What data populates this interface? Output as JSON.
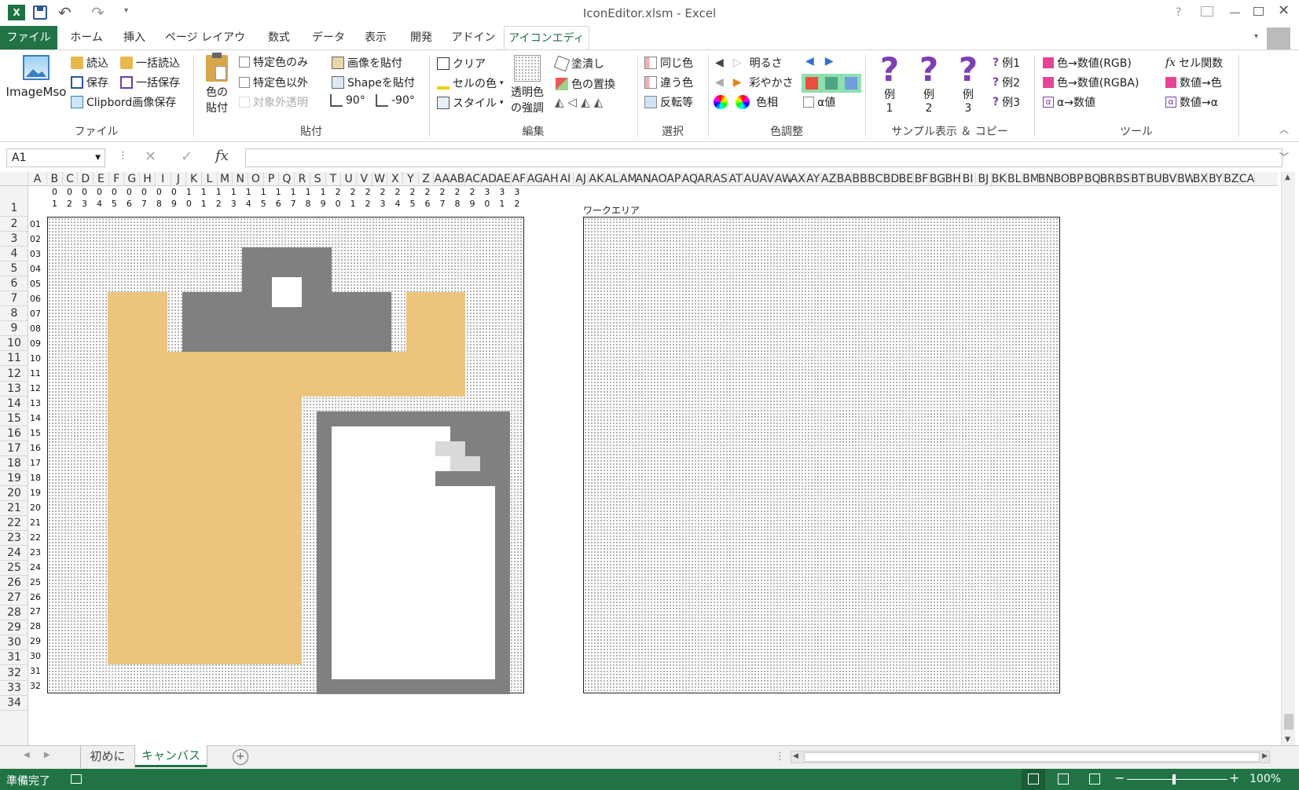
{
  "window": {
    "title": "IconEditor.xlsm - Excel"
  },
  "tabs": [
    "ファイル",
    "ホーム",
    "挿入",
    "ページ レイアウト",
    "数式",
    "データ",
    "表示",
    "開発",
    "アドイン",
    "アイコンエディタ"
  ],
  "ribbon": {
    "file": {
      "imagemso": "ImageMso",
      "load": "読込",
      "bulk_load": "一括読込",
      "save": "保存",
      "bulk_save": "一括保存",
      "clipboard_save": "Clipbord画像保存",
      "group": "ファイル"
    },
    "paste": {
      "color_paste_1": "色の",
      "color_paste_2": "貼付",
      "specific_only": "特定色のみ",
      "specific_except": "特定色以外",
      "transparent": "対象外透明",
      "paste_image": "画像を貼付",
      "paste_shape": "Shapeを貼付",
      "rot90": "90°",
      "rotm90": "-90°",
      "group": "貼付"
    },
    "edit": {
      "clear": "クリア",
      "cell_color": "セルの色",
      "style": "スタイル",
      "emph_1": "透明色",
      "emph_2": "の強調",
      "fill": "塗潰し",
      "replace": "色の置換",
      "group": "編集"
    },
    "select": {
      "same": "同じ色",
      "diff": "違う色",
      "invert": "反転等",
      "group": "選択"
    },
    "color": {
      "brightness": "明るさ",
      "saturation": "彩やかさ",
      "hue": "色相",
      "alpha": "α値",
      "group": "色調整",
      "swatches": [
        "#e8503a",
        "#4ea584",
        "#6e9de0"
      ]
    },
    "sample": {
      "ex_label": "例",
      "ex_nums": [
        "1",
        "2",
        "3"
      ],
      "ex1": "例1",
      "ex2": "例2",
      "ex3": "例3",
      "group": "サンプル表示 ＆ コピー"
    },
    "tools": {
      "c2rgb": "色→数値(RGB)",
      "c2rgba": "色→数値(RGBA)",
      "a2num": "α→数値",
      "cellfunc": "セル関数",
      "num2c": "数値→色",
      "num2a": "数値→α",
      "group": "ツール"
    }
  },
  "formula": {
    "namebox": "A1",
    "value": ""
  },
  "sheet": {
    "col_headers": [
      "A",
      "B",
      "C",
      "D",
      "E",
      "F",
      "G",
      "H",
      "I",
      "J",
      "K",
      "L",
      "M",
      "N",
      "O",
      "P",
      "Q",
      "R",
      "S",
      "T",
      "U",
      "V",
      "W",
      "X",
      "Y",
      "Z",
      "AA",
      "AB",
      "AC",
      "AD",
      "AE",
      "AF",
      "AG",
      "AH",
      "AI",
      "AJ",
      "AK",
      "AL",
      "AM",
      "AN",
      "AO",
      "AP",
      "AQ",
      "AR",
      "AS",
      "AT",
      "AU",
      "AV",
      "AW",
      "AX",
      "AY",
      "AZ",
      "BA",
      "BB",
      "BC",
      "BD",
      "BE",
      "BF",
      "BG",
      "BH",
      "BI",
      "BJ",
      "BK",
      "BL",
      "BM",
      "BN",
      "BO",
      "BP",
      "BQ",
      "BR",
      "BS",
      "BT",
      "BU",
      "BV",
      "BW",
      "BX",
      "BY",
      "BZ",
      "CA"
    ],
    "col_tens": [
      "0",
      "0",
      "0",
      "0",
      "0",
      "0",
      "0",
      "0",
      "0",
      "1",
      "1",
      "1",
      "1",
      "1",
      "1",
      "1",
      "1",
      "1",
      "1",
      "2",
      "2",
      "2",
      "2",
      "2",
      "2",
      "2",
      "2",
      "2",
      "2",
      "3",
      "3",
      "3"
    ],
    "col_ones": [
      "1",
      "2",
      "3",
      "4",
      "5",
      "6",
      "7",
      "8",
      "9",
      "0",
      "1",
      "2",
      "3",
      "4",
      "5",
      "6",
      "7",
      "8",
      "9",
      "0",
      "1",
      "2",
      "3",
      "4",
      "5",
      "6",
      "7",
      "8",
      "9",
      "0",
      "1",
      "2"
    ],
    "row_headers": [
      "1",
      "2",
      "3",
      "4",
      "5",
      "6",
      "7",
      "8",
      "9",
      "10",
      "11",
      "12",
      "13",
      "14",
      "15",
      "16",
      "17",
      "18",
      "19",
      "20",
      "21",
      "22",
      "23",
      "24",
      "25",
      "26",
      "27",
      "28",
      "29",
      "30",
      "31",
      "32",
      "33",
      "34"
    ],
    "row_labels": [
      "01",
      "02",
      "03",
      "04",
      "05",
      "06",
      "07",
      "08",
      "09",
      "10",
      "11",
      "12",
      "13",
      "14",
      "15",
      "16",
      "17",
      "18",
      "19",
      "20",
      "21",
      "22",
      "23",
      "24",
      "25",
      "26",
      "27",
      "28",
      "29",
      "30",
      "31",
      "32"
    ],
    "work_area_label": "ワークエリア",
    "palette": {
      "tan": "#ebc57d",
      "gray": "#808080",
      "white": "#ffffff",
      "light": "#d9d9d9"
    }
  },
  "sheet_tabs": [
    "初めに",
    "キャンバス"
  ],
  "status": {
    "ready": "準備完了",
    "zoom": "100%"
  }
}
